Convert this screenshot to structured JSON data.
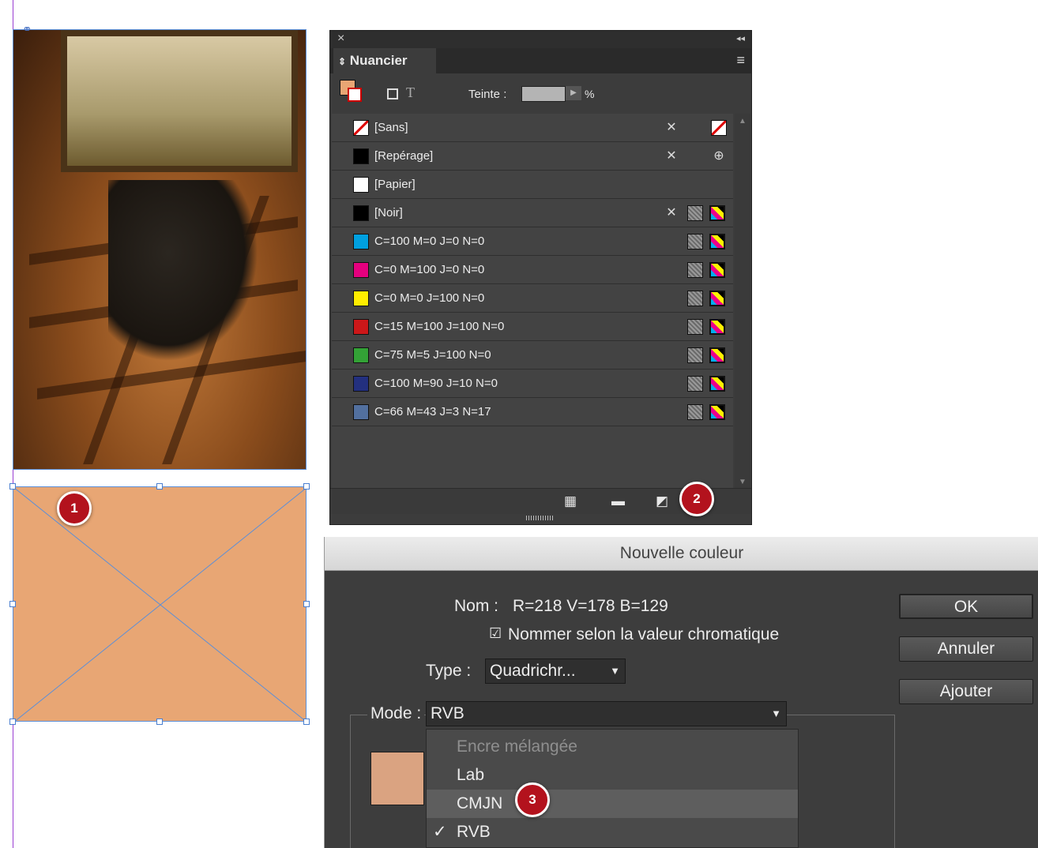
{
  "panel": {
    "tab_label": "Nuancier",
    "close_glyph": "×",
    "collapse_glyph": "◂◂",
    "menu_glyph": "≡",
    "tint_label": "Teinte :",
    "tint_unit": "%",
    "swatches": [
      {
        "name": "[Sans]",
        "color": "#ffffff",
        "kind": "none"
      },
      {
        "name": "[Repérage]",
        "color": "#000000",
        "kind": "registration"
      },
      {
        "name": "[Papier]",
        "color": "#ffffff",
        "kind": "paper"
      },
      {
        "name": "[Noir]",
        "color": "#000000",
        "kind": "black"
      },
      {
        "name": "C=100 M=0 J=0 N=0",
        "color": "#00a0e0",
        "kind": "process"
      },
      {
        "name": "C=0 M=100 J=0 N=0",
        "color": "#e5007e",
        "kind": "process"
      },
      {
        "name": "C=0 M=0 J=100 N=0",
        "color": "#ffed00",
        "kind": "process"
      },
      {
        "name": "C=15 M=100 J=100 N=0",
        "color": "#cc1719",
        "kind": "process"
      },
      {
        "name": "C=75 M=5 J=100 N=0",
        "color": "#33a236",
        "kind": "process"
      },
      {
        "name": "C=100 M=90 J=10 N=0",
        "color": "#23307f",
        "kind": "process"
      },
      {
        "name": "C=66 M=43 J=3 N=17",
        "color": "#52709f",
        "kind": "process"
      }
    ]
  },
  "badges": {
    "one": "1",
    "two": "2",
    "three": "3"
  },
  "dialog": {
    "title": "Nouvelle couleur",
    "name_label": "Nom :",
    "name_value": "R=218 V=178 B=129",
    "auto_name_checkbox": "Nommer selon la valeur chromatique",
    "type_label": "Type :",
    "type_value": "Quadrichr...",
    "mode_label": "Mode :",
    "mode_value": "RVB",
    "buttons": {
      "ok": "OK",
      "cancel": "Annuler",
      "add": "Ajouter"
    },
    "mode_options": [
      {
        "label": "Encre mélangée",
        "state": "disabled"
      },
      {
        "label": "Lab",
        "state": "normal"
      },
      {
        "label": "CMJN",
        "state": "hover"
      },
      {
        "label": "RVB",
        "state": "checked"
      }
    ],
    "preview_color": "#daa381"
  },
  "colors": {
    "frame_fill": "#e8a674",
    "selection_blue": "#5b8fd8",
    "badge_red": "#b3121d"
  }
}
